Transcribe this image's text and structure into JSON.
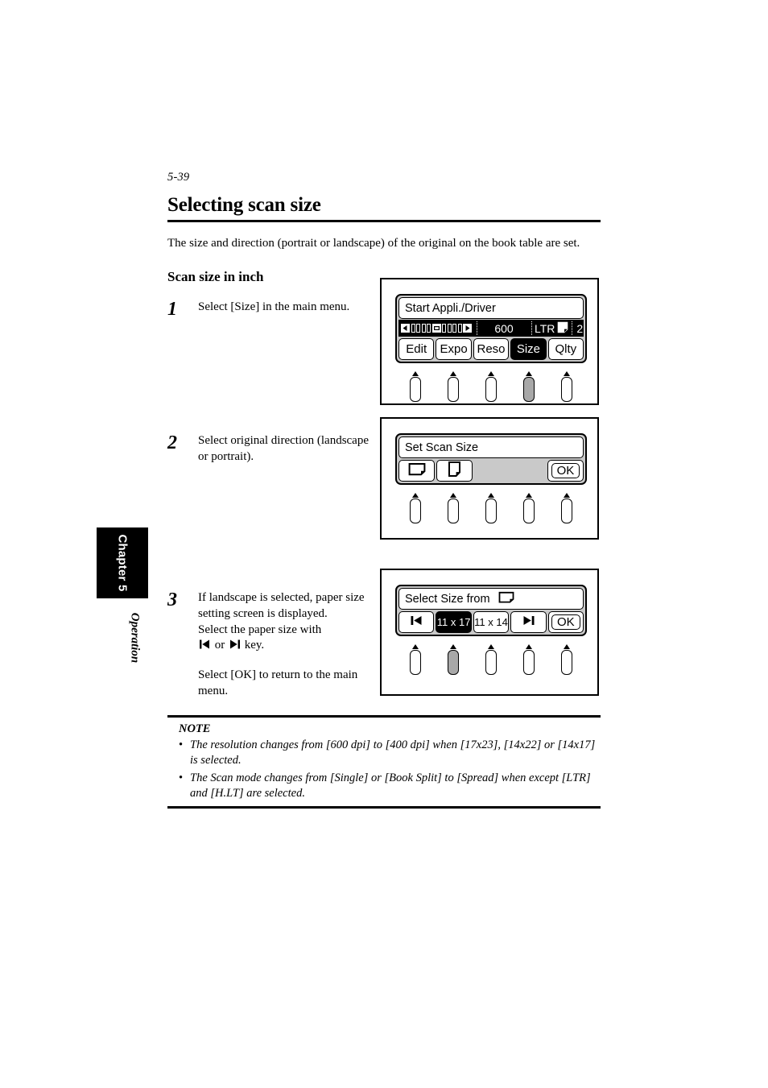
{
  "page": {
    "folio": "5-39",
    "title": "Selecting scan size",
    "intro": "The size and direction (portrait or landscape) of the original on the book table are set.",
    "subtitle": "Scan size in inch"
  },
  "side_tab": {
    "chapter": "Chapter 5",
    "section": "Operation"
  },
  "steps": [
    {
      "number": "1",
      "lines": [
        "Select [Size] in the main menu."
      ]
    },
    {
      "number": "2",
      "lines": [
        "Select original direction (landscape or portrait)."
      ]
    },
    {
      "number": "3",
      "lines_part1_a": "If landscape is selected, paper size setting screen is displayed.",
      "lines_part1_b": "Select the paper size with",
      "key_or": "or",
      "key_tail": "key.",
      "lines_part2": "Select [OK] to return to the main menu."
    }
  ],
  "panels": [
    {
      "title": "Start Appli./Driver",
      "status": {
        "resolution": "600",
        "paper": "LTR",
        "paper_icon": "portrait-page-icon",
        "count": "2"
      },
      "buttons": [
        {
          "label": "Edit",
          "state": "normal"
        },
        {
          "label": "Expo",
          "state": "normal"
        },
        {
          "label": "Reso",
          "state": "normal"
        },
        {
          "label": "Size",
          "state": "selected"
        },
        {
          "label": "Qlty",
          "state": "normal"
        }
      ],
      "keys": [
        "up",
        "up",
        "up",
        "pressed",
        "up"
      ]
    },
    {
      "title": "Set Scan Size",
      "buttons": [
        {
          "label": "",
          "icon": "landscape-page-icon",
          "state": "normal"
        },
        {
          "label": "",
          "icon": "portrait-page-icon",
          "state": "normal"
        },
        {
          "label": "",
          "state": "blank"
        },
        {
          "label": "",
          "state": "blank"
        },
        {
          "label": "OK",
          "state": "ok"
        }
      ],
      "keys": [
        "up",
        "up",
        "up",
        "up",
        "up"
      ]
    },
    {
      "title": "Select Size from",
      "title_icon": "landscape-page-icon",
      "buttons": [
        {
          "label": "",
          "icon": "prev-arrow-icon",
          "state": "normal"
        },
        {
          "label": "11 x 17",
          "state": "selected"
        },
        {
          "label": "11 x 14",
          "state": "normal"
        },
        {
          "label": "",
          "icon": "next-arrow-icon",
          "state": "normal"
        },
        {
          "label": "OK",
          "state": "ok"
        }
      ],
      "keys": [
        "up",
        "pressed",
        "up",
        "up",
        "up"
      ]
    }
  ],
  "note": {
    "heading": "NOTE",
    "items": [
      "The resolution changes from [600 dpi] to [400 dpi] when [17x23], [14x22] or [14x17] is selected.",
      "The Scan mode changes from [Single] or [Book Split] to [Spread] when except [LTR] and [H.LT] are selected."
    ]
  },
  "colors": {
    "ink": "#000000",
    "paper": "#ffffff",
    "lcd_body": "#c9c9c9",
    "key_pressed": "#a8a8a8"
  }
}
